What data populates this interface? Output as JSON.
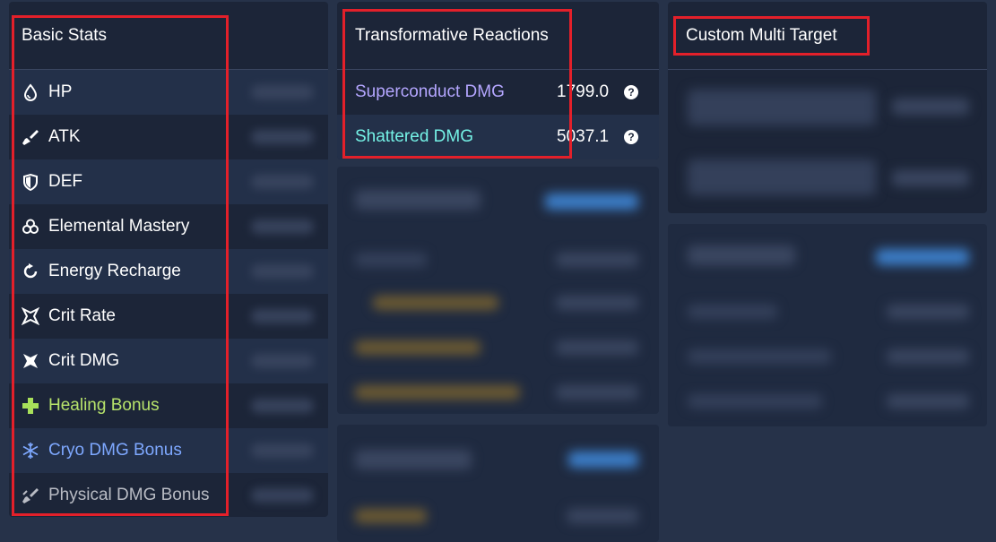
{
  "basic_stats": {
    "title": "Basic Stats",
    "items": [
      {
        "label": "HP",
        "icon": "drop-icon",
        "color": "#ffffff"
      },
      {
        "label": "ATK",
        "icon": "sword-icon",
        "color": "#ffffff"
      },
      {
        "label": "DEF",
        "icon": "shield-icon",
        "color": "#ffffff"
      },
      {
        "label": "Elemental Mastery",
        "icon": "atom-icon",
        "color": "#ffffff"
      },
      {
        "label": "Energy Recharge",
        "icon": "recharge-icon",
        "color": "#ffffff"
      },
      {
        "label": "Crit Rate",
        "icon": "crit-rate-icon",
        "color": "#ffffff"
      },
      {
        "label": "Crit DMG",
        "icon": "crit-dmg-icon",
        "color": "#ffffff"
      },
      {
        "label": "Healing Bonus",
        "icon": "plus-icon",
        "color": "#b7e36b"
      },
      {
        "label": "Cryo DMG Bonus",
        "icon": "snowflake-icon",
        "color": "#7ea8ff"
      },
      {
        "label": "Physical DMG Bonus",
        "icon": "physical-icon",
        "color": "#b9bcc4"
      }
    ]
  },
  "transformative": {
    "title": "Transformative Reactions",
    "items": [
      {
        "label": "Superconduct DMG",
        "value": "1799.0",
        "color": "#b4a6ff"
      },
      {
        "label": "Shattered DMG",
        "value": "5037.1",
        "color": "#75f2e6"
      }
    ],
    "help_glyph": "?"
  },
  "custom_multi": {
    "title": "Custom Multi Target"
  }
}
